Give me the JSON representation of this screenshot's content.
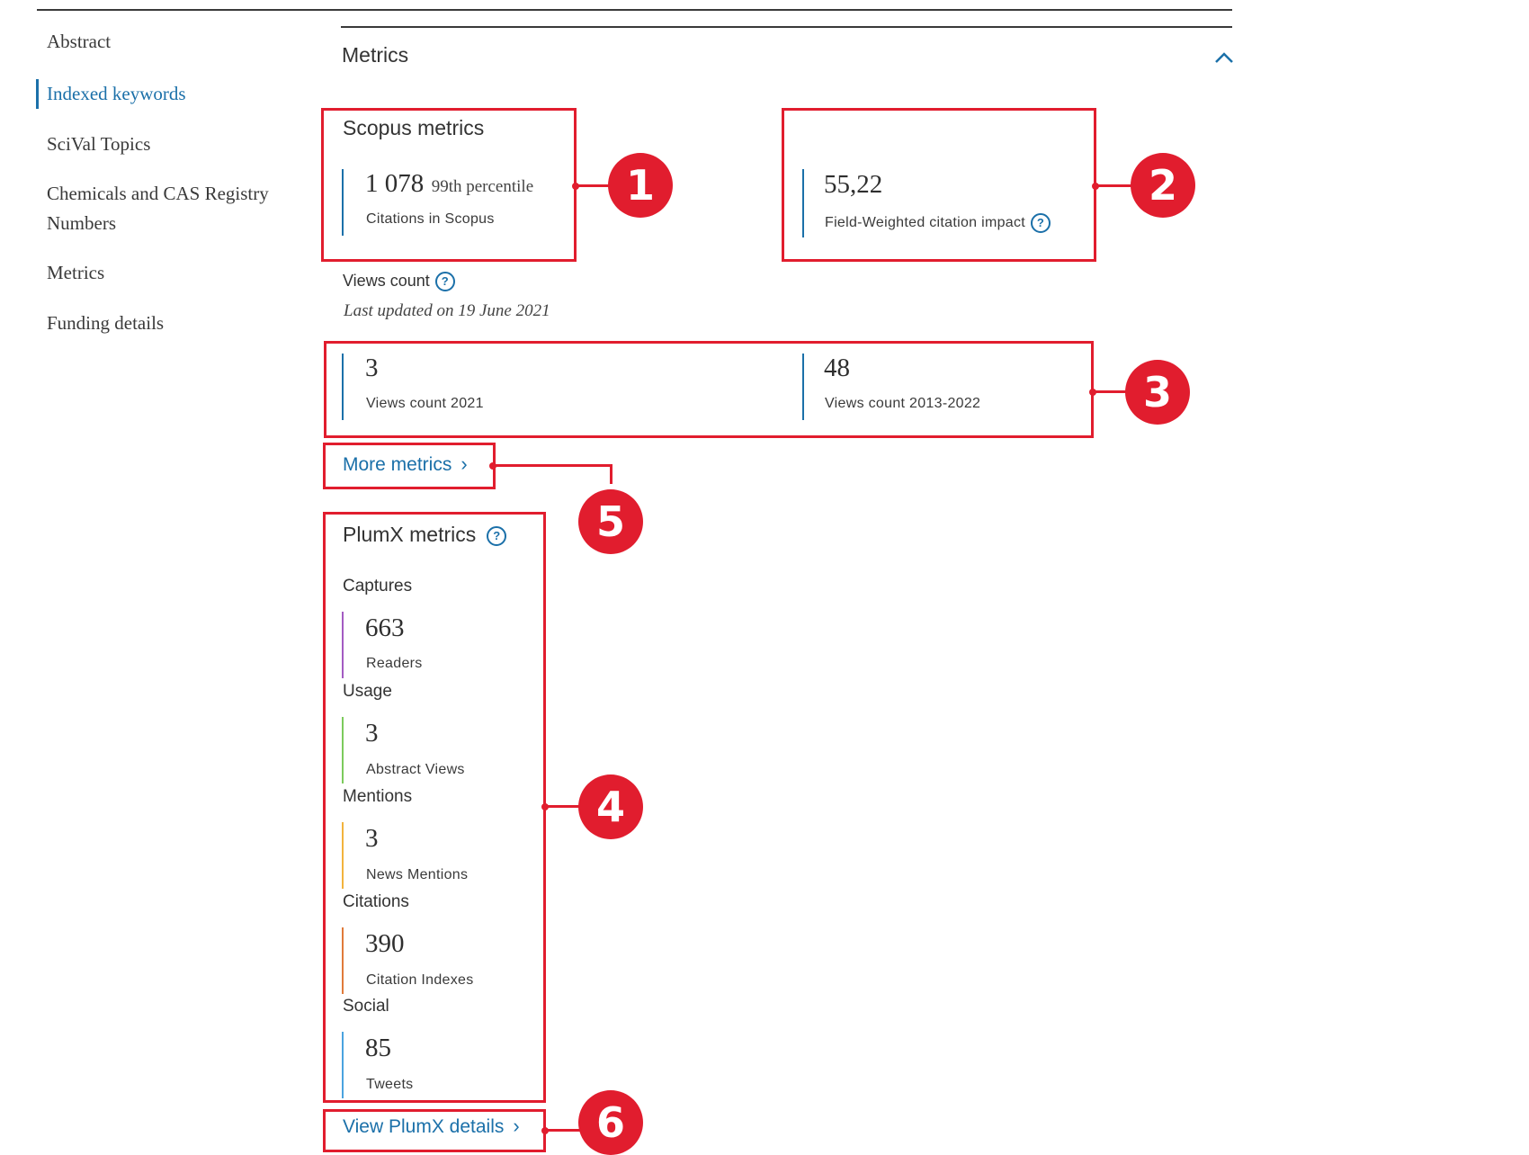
{
  "nav": {
    "items": [
      {
        "label": "Abstract"
      },
      {
        "label": "Indexed keywords"
      },
      {
        "label": "SciVal Topics"
      },
      {
        "label": "Chemicals and CAS Registry Numbers"
      },
      {
        "label": "Metrics"
      },
      {
        "label": "Funding details"
      }
    ]
  },
  "metrics": {
    "section_title": "Metrics",
    "scopus": {
      "title": "Scopus metrics",
      "citations_value": "1 078",
      "citations_percentile": "99th percentile",
      "citations_label": "Citations in Scopus",
      "fwci_value": "55,22",
      "fwci_label": "Field-Weighted citation impact"
    },
    "views": {
      "title": "Views count",
      "updated": "Last updated on 19 June 2021",
      "year_value": "3",
      "year_label": "Views count 2021",
      "range_value": "48",
      "range_label": "Views count 2013-2022"
    },
    "more_metrics_label": "More metrics",
    "plumx": {
      "title": "PlumX metrics",
      "groups": [
        {
          "category": "Captures",
          "value": "663",
          "label": "Readers",
          "color": "#a35bc2"
        },
        {
          "category": "Usage",
          "value": "3",
          "label": "Abstract Views",
          "color": "#7ccb5c"
        },
        {
          "category": "Mentions",
          "value": "3",
          "label": "News Mentions",
          "color": "#f2b33d"
        },
        {
          "category": "Citations",
          "value": "390",
          "label": "Citation Indexes",
          "color": "#e07a3a"
        },
        {
          "category": "Social",
          "value": "85",
          "label": "Tweets",
          "color": "#4aa3df"
        }
      ],
      "details_label": "View PlumX details"
    }
  },
  "annotations": {
    "badges": [
      "1",
      "2",
      "3",
      "4",
      "5",
      "6"
    ],
    "color": "#e11d2e"
  },
  "colors": {
    "accent": "#1b70a9",
    "scopus_bar": "#1b70a9"
  },
  "icons": {
    "help": "?",
    "chevron_right": "›",
    "chevron_up": "chevron-up-icon"
  }
}
